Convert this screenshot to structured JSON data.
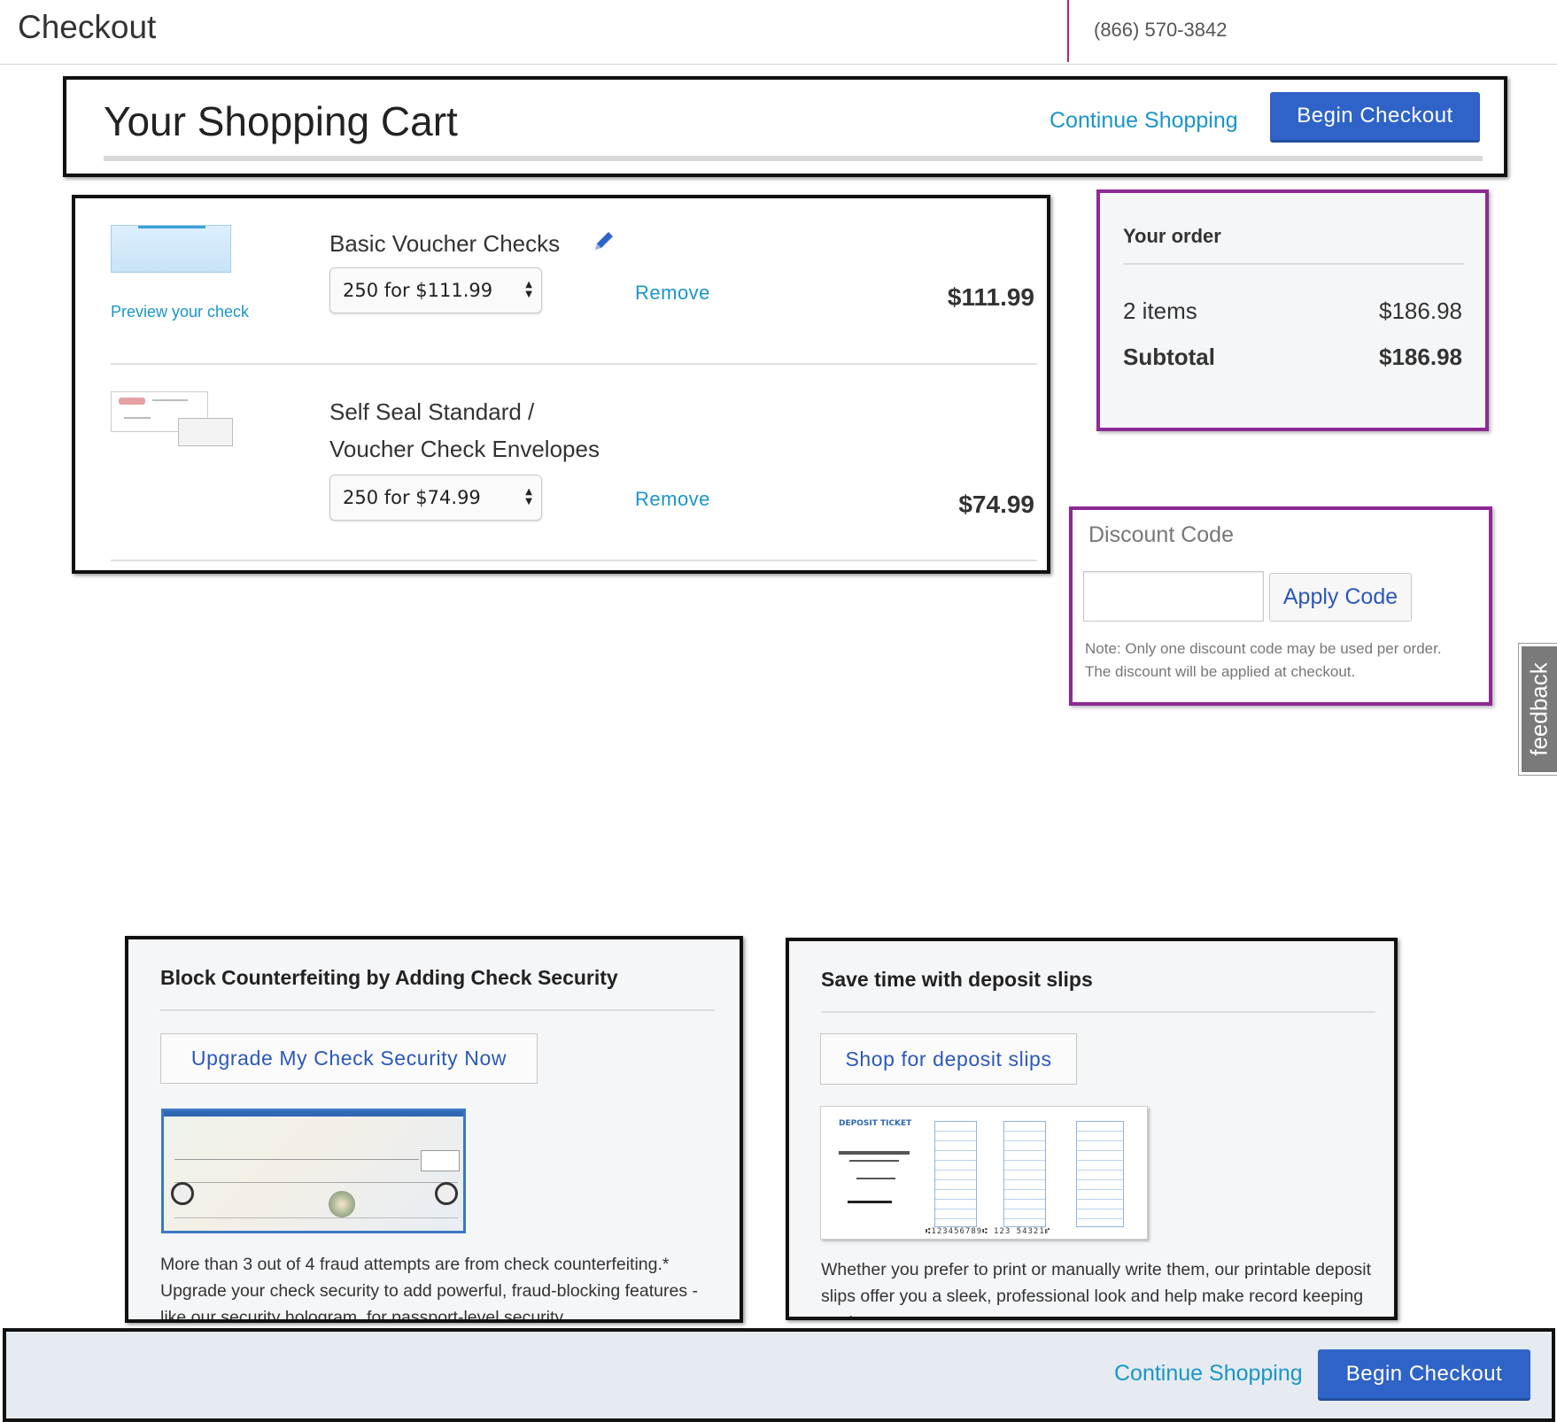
{
  "topbar": {
    "title": "Checkout",
    "phone": "(866) 570-3842"
  },
  "cart_header": {
    "heading": "Your Shopping Cart",
    "continue_label": "Continue Shopping",
    "checkout_label": "Begin Checkout"
  },
  "items": [
    {
      "name": "Basic Voucher Checks",
      "preview_link": "Preview your check",
      "quantity_option": "250 for $111.99",
      "remove_label": "Remove",
      "price": "$111.99"
    },
    {
      "name_line1": "Self Seal Standard /",
      "name_line2": "Voucher Check Envelopes",
      "quantity_option": "250 for $74.99",
      "remove_label": "Remove",
      "price": "$74.99"
    }
  ],
  "order_summary": {
    "title": "Your order",
    "items_count": "2 items",
    "items_total": "$186.98",
    "subtotal_label": "Subtotal",
    "subtotal": "$186.98"
  },
  "discount": {
    "title": "Discount Code",
    "input_value": "",
    "apply_label": "Apply Code",
    "note_line1": "Note: Only one discount code may be used per order.",
    "note_line2": "The discount will be applied at checkout."
  },
  "feedback_label": "feedback",
  "promos": [
    {
      "title": "Block Counterfeiting by Adding Check Security",
      "button_label": "Upgrade My Check Security Now",
      "text": "More than 3 out of 4 fraud attempts are from check counterfeiting.* Upgrade your check security to add powerful, fraud-blocking features - like our security hologram, for passport-level security."
    },
    {
      "title": "Save time with deposit slips",
      "button_label": "Shop for deposit slips",
      "text": "Whether you prefer to print or manually write them, our printable deposit slips offer you a sleek, professional look and help make record keeping easier."
    }
  ],
  "footer": {
    "continue_label": "Continue Shopping",
    "checkout_label": "Begin Checkout"
  },
  "colors": {
    "primary_button": "#2f63c7",
    "link": "#1a95c9",
    "highlight_border": "#8d2a94",
    "top_divider": "#b9227a"
  }
}
